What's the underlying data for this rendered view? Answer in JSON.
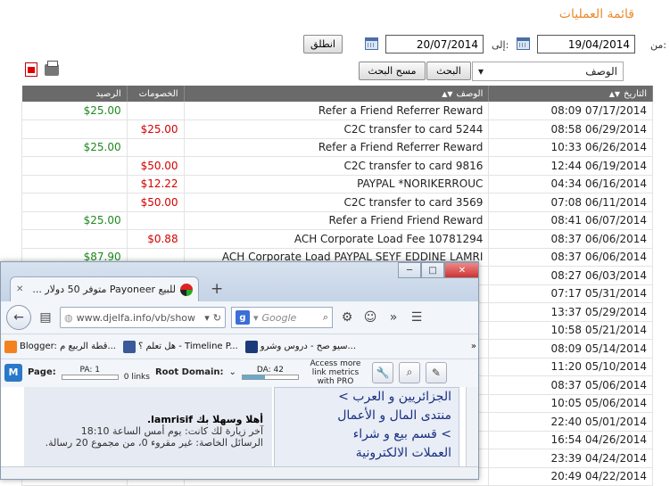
{
  "page": {
    "title": "قائمة العمليات"
  },
  "filters": {
    "from_label": "من:",
    "from_date": "19/04/2014",
    "to_label": "إلى:",
    "to_date": "20/07/2014",
    "go_label": "انطلق",
    "search_field": "الوصف",
    "search_value": "",
    "search_label": "البحث",
    "clear_label": "مسح البحث"
  },
  "table": {
    "headers": {
      "date": "التاريخ",
      "desc": "الوصف",
      "deduction": "الخصومات",
      "balance": "الرصيد"
    },
    "rows": [
      {
        "date": "08:09 07/17/2014",
        "desc": "Refer a Friend Referrer Reward",
        "deduction": "",
        "balance": "$25.00"
      },
      {
        "date": "08:58 06/29/2014",
        "desc": "C2C transfer to card 5244",
        "deduction": "$25.00",
        "balance": ""
      },
      {
        "date": "10:33 06/26/2014",
        "desc": "Refer a Friend Referrer Reward",
        "deduction": "",
        "balance": "$25.00"
      },
      {
        "date": "12:44 06/19/2014",
        "desc": "C2C transfer to card 9816",
        "deduction": "$50.00",
        "balance": ""
      },
      {
        "date": "04:34 06/16/2014",
        "desc": "PAYPAL *NORIKERROUC",
        "deduction": "$12.22",
        "balance": ""
      },
      {
        "date": "07:08 06/11/2014",
        "desc": "C2C transfer to card 3569",
        "deduction": "$50.00",
        "balance": ""
      },
      {
        "date": "08:41 06/07/2014",
        "desc": "Refer a Friend Friend Reward",
        "deduction": "",
        "balance": "$25.00"
      },
      {
        "date": "08:37 06/06/2014",
        "desc": "ACH Corporate Load Fee 10781294",
        "deduction": "$0.88",
        "balance": ""
      },
      {
        "date": "08:37 06/06/2014",
        "desc": "ACH Corporate Load PAYPAL SEYF EDDINE LAMRI",
        "deduction": "",
        "balance": "$87.90"
      },
      {
        "date": "08:27 06/03/2014",
        "desc": "",
        "deduction": "",
        "balance": ""
      },
      {
        "date": "07:17 05/31/2014",
        "desc": "",
        "deduction": "",
        "balance": ""
      },
      {
        "date": "13:37 05/29/2014",
        "desc": "",
        "deduction": "",
        "balance": ""
      },
      {
        "date": "10:58 05/21/2014",
        "desc": "",
        "deduction": "",
        "balance": ""
      },
      {
        "date": "08:09 05/14/2014",
        "desc": "",
        "deduction": "",
        "balance": ""
      },
      {
        "date": "11:20 05/10/2014",
        "desc": "",
        "deduction": "",
        "balance": ""
      },
      {
        "date": "08:37 05/06/2014",
        "desc": "",
        "deduction": "",
        "balance": ""
      },
      {
        "date": "10:05 05/06/2014",
        "desc": "",
        "deduction": "",
        "balance": ""
      },
      {
        "date": "22:40 05/01/2014",
        "desc": "",
        "deduction": "",
        "balance": ""
      },
      {
        "date": "16:54 04/26/2014",
        "desc": "",
        "deduction": "",
        "balance": ""
      },
      {
        "date": "23:39 04/24/2014",
        "desc": "",
        "deduction": "",
        "balance": ""
      },
      {
        "date": "20:49 04/22/2014",
        "desc": "",
        "deduction": "",
        "balance": ""
      }
    ]
  },
  "browser": {
    "tab_title": "للبيع Payoneer متوفر 50 دولار ...",
    "url": "www.djelfa.info/vb/show",
    "search_placeholder": "Google",
    "bookmarks": [
      "Blogger: قطة الربيع م...",
      "هل تعلم ؟ - Timeline P...",
      "سيو صح - دروس وشرو..."
    ],
    "seo": {
      "page_label": "Page:",
      "pa": "PA: 1",
      "links": "0 links",
      "root_label": "Root Domain:",
      "da": "DA: 42",
      "access": "Access more link metrics with PRO"
    },
    "welcome": "أهلا وسهلا بك lamrisif.",
    "last_visit": "آخر زيارة لك كانت: يوم أمس الساعة 18:10",
    "messages": "الرسائل الخاصة: غير مقروء 0، من مجموع 20 رسالة.",
    "forum_lines": [
      "الجزائريين و العرب >",
      "منتدى المال و الأعمال",
      "> قسم بيع و شراء",
      "العملات الالكترونية"
    ]
  },
  "colors": {
    "accent": "#e98a2b",
    "positive": "#1e8a1e",
    "negative": "#d40000",
    "header_bg": "#6a6a6a"
  }
}
